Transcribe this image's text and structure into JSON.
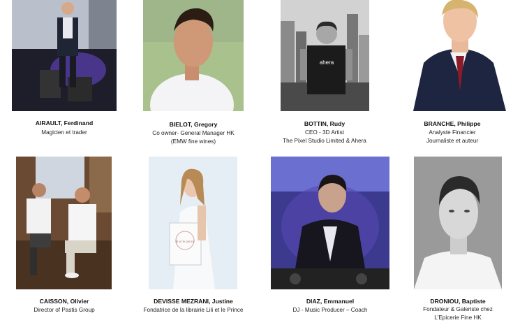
{
  "people": [
    {
      "name": "AIRAULT, Ferdinand",
      "lines": [
        "Magicien et trader"
      ]
    },
    {
      "name": "BIELOT, Gregory",
      "lines": [
        "Co owner- General Manager HK",
        "(EMW fine wines)"
      ]
    },
    {
      "name": "BOTTIN, Rudy",
      "lines": [
        "CEO - 3D Artist",
        "The Pixel Studio Limited & Ahera"
      ]
    },
    {
      "name": "BRANCHE, Philippe",
      "lines": [
        "Analyste Financier",
        "Journaliste et auteur"
      ]
    },
    {
      "name": "CAISSON, Olivier",
      "lines": [
        "Director of Pastis Group"
      ]
    },
    {
      "name": "DEVISSE MEZRANI, Justine",
      "lines": [
        "Fondatrice de la librairie Lili et le Prince"
      ]
    },
    {
      "name": "DIAZ, Emmanuel",
      "lines": [
        "DJ - Music Producer – Coach"
      ]
    },
    {
      "name": "DRONIOU, Baptiste",
      "lines": [
        "Fondateur & Galeriste chez",
        "L'Epicerie Fine HK"
      ]
    }
  ],
  "photo_texts": {
    "tshirt_logo": "ahera",
    "tote_text": "lili et le prince"
  }
}
